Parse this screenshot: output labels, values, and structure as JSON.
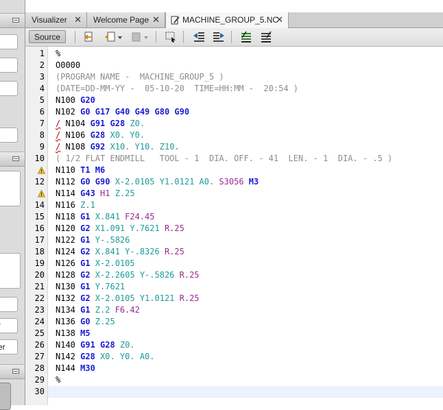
{
  "tabs": [
    {
      "label": "Visualizer",
      "active": false
    },
    {
      "label": "Welcome Page",
      "active": false
    },
    {
      "label": "MACHINE_GROUP_5.NC",
      "active": true
    }
  ],
  "toolbar": {
    "source_label": "Source",
    "icons": [
      "go-back-icon",
      "history-icon",
      "disabled-dropdown-icon",
      "select-icon",
      "shift-left-icon",
      "shift-right-icon",
      "comment-icon",
      "uncomment-icon"
    ]
  },
  "sidebar": {
    "fields": [
      "",
      "",
      "",
      "",
      "",
      "r",
      "er"
    ]
  },
  "editor": {
    "line_numbers": [
      "1",
      "2",
      "3",
      "4",
      "5",
      "6",
      "7",
      "8",
      "9",
      "10",
      "11",
      "12",
      "13",
      "14",
      "15",
      "16",
      "17",
      "18",
      "19",
      "20",
      "21",
      "22",
      "23",
      "24",
      "25",
      "26",
      "27",
      "28",
      "29",
      "30"
    ],
    "warning_lines": [
      "11",
      "13"
    ],
    "lines": [
      [
        {
          "t": "%",
          "c": ""
        }
      ],
      [
        {
          "t": "O0000",
          "c": ""
        }
      ],
      [
        {
          "t": "(PROGRAM NAME -  MACHINE_GROUP_5 )",
          "c": "cm"
        }
      ],
      [
        {
          "t": "(DATE=DD-MM-YY -  05-10-20  TIME=HH:MM -  20:54 )",
          "c": "cm"
        }
      ],
      [
        {
          "t": "N100 ",
          "c": ""
        },
        {
          "t": "G20",
          "c": "kw"
        }
      ],
      [
        {
          "t": "N102 ",
          "c": ""
        },
        {
          "t": "G0 G17 G40 G49 G80 G90",
          "c": "kw"
        }
      ],
      [
        {
          "t": "/",
          "c": "sl"
        },
        {
          "t": " N104 ",
          "c": ""
        },
        {
          "t": "G91 G28",
          "c": "kw"
        },
        {
          "t": " Z0.",
          "c": "cy"
        }
      ],
      [
        {
          "t": "/",
          "c": "sl"
        },
        {
          "t": " N106 ",
          "c": ""
        },
        {
          "t": "G28",
          "c": "kw"
        },
        {
          "t": " X0. Y0.",
          "c": "cy"
        }
      ],
      [
        {
          "t": "/",
          "c": "sl"
        },
        {
          "t": " N108 ",
          "c": ""
        },
        {
          "t": "G92",
          "c": "kw"
        },
        {
          "t": " X10. Y10. Z10.",
          "c": "cy"
        }
      ],
      [
        {
          "t": "( 1/2 FLAT ENDMILL   TOOL - 1  DIA. OFF. - 41  LEN. - 1  DIA. - .5 )",
          "c": "cm"
        }
      ],
      [
        {
          "t": "N110 ",
          "c": ""
        },
        {
          "t": "T1 M6",
          "c": "kw"
        }
      ],
      [
        {
          "t": "N112 ",
          "c": ""
        },
        {
          "t": "G0 G90",
          "c": "kw"
        },
        {
          "t": " X-2.0105 Y1.0121 A0.",
          "c": "cy"
        },
        {
          "t": " S3056",
          "c": "mg"
        },
        {
          "t": " M3",
          "c": "kw"
        }
      ],
      [
        {
          "t": "N114 ",
          "c": ""
        },
        {
          "t": "G43",
          "c": "kw"
        },
        {
          "t": " H1",
          "c": "mg"
        },
        {
          "t": " Z.25",
          "c": "cy"
        }
      ],
      [
        {
          "t": "N116 ",
          "c": ""
        },
        {
          "t": "Z.1",
          "c": "cy"
        }
      ],
      [
        {
          "t": "N118 ",
          "c": ""
        },
        {
          "t": "G1",
          "c": "kw"
        },
        {
          "t": " X.841",
          "c": "cy"
        },
        {
          "t": " F24.45",
          "c": "mg"
        }
      ],
      [
        {
          "t": "N120 ",
          "c": ""
        },
        {
          "t": "G2",
          "c": "kw"
        },
        {
          "t": " X1.091 Y.7621",
          "c": "cy"
        },
        {
          "t": " R.25",
          "c": "mg"
        }
      ],
      [
        {
          "t": "N122 ",
          "c": ""
        },
        {
          "t": "G1",
          "c": "kw"
        },
        {
          "t": " Y-.5826",
          "c": "cy"
        }
      ],
      [
        {
          "t": "N124 ",
          "c": ""
        },
        {
          "t": "G2",
          "c": "kw"
        },
        {
          "t": " X.841 Y-.8326",
          "c": "cy"
        },
        {
          "t": " R.25",
          "c": "mg"
        }
      ],
      [
        {
          "t": "N126 ",
          "c": ""
        },
        {
          "t": "G1",
          "c": "kw"
        },
        {
          "t": " X-2.0105",
          "c": "cy"
        }
      ],
      [
        {
          "t": "N128 ",
          "c": ""
        },
        {
          "t": "G2",
          "c": "kw"
        },
        {
          "t": " X-2.2605 Y-.5826",
          "c": "cy"
        },
        {
          "t": " R.25",
          "c": "mg"
        }
      ],
      [
        {
          "t": "N130 ",
          "c": ""
        },
        {
          "t": "G1",
          "c": "kw"
        },
        {
          "t": " Y.7621",
          "c": "cy"
        }
      ],
      [
        {
          "t": "N132 ",
          "c": ""
        },
        {
          "t": "G2",
          "c": "kw"
        },
        {
          "t": " X-2.0105 Y1.0121",
          "c": "cy"
        },
        {
          "t": " R.25",
          "c": "mg"
        }
      ],
      [
        {
          "t": "N134 ",
          "c": ""
        },
        {
          "t": "G1",
          "c": "kw"
        },
        {
          "t": " Z.2",
          "c": "cy"
        },
        {
          "t": " F6.42",
          "c": "mg"
        }
      ],
      [
        {
          "t": "N136 ",
          "c": ""
        },
        {
          "t": "G0",
          "c": "kw"
        },
        {
          "t": " Z.25",
          "c": "cy"
        }
      ],
      [
        {
          "t": "N138 ",
          "c": ""
        },
        {
          "t": "M5",
          "c": "kw"
        }
      ],
      [
        {
          "t": "N140 ",
          "c": ""
        },
        {
          "t": "G91 G28",
          "c": "kw"
        },
        {
          "t": " Z0.",
          "c": "cy"
        }
      ],
      [
        {
          "t": "N142 ",
          "c": ""
        },
        {
          "t": "G28",
          "c": "kw"
        },
        {
          "t": " X0. Y0. A0.",
          "c": "cy"
        }
      ],
      [
        {
          "t": "N144 ",
          "c": ""
        },
        {
          "t": "M30",
          "c": "kw"
        }
      ],
      [
        {
          "t": "%",
          "c": ""
        }
      ],
      []
    ]
  },
  "colors": {
    "keyword": "#1b1bd6",
    "comment": "#8c8c8c",
    "coordinate": "#1e9a9a",
    "parameter": "#9a2a8e",
    "current_line": "#eaf2fb"
  }
}
